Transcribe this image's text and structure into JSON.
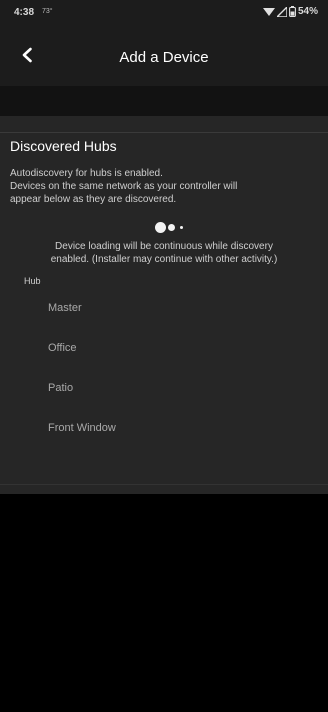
{
  "status_bar": {
    "time": "4:38",
    "temperature": "73°",
    "battery": "54%",
    "icons": [
      "wifi-icon",
      "signal-icon",
      "battery-icon"
    ]
  },
  "header": {
    "title": "Add a Device",
    "back_icon": "chevron-left-icon"
  },
  "discovered": {
    "title": "Discovered Hubs",
    "description_lines": [
      "Autodiscovery for hubs is enabled.",
      "Devices on the same network as your controller will",
      "appear below as they are discovered."
    ],
    "note_lines": [
      "Device loading will be continuous while discovery",
      "enabled. (Installer may continue with other activity.)"
    ],
    "list_header": "Hub",
    "hubs": [
      {
        "label": "Master"
      },
      {
        "label": "Office"
      },
      {
        "label": "Patio"
      },
      {
        "label": "Front Window"
      }
    ]
  },
  "colors": {
    "background": "#000000",
    "header": "#1c1c1c",
    "panel": "#262626",
    "text": "#e6e6e6",
    "muted_text": "#a9a9a9"
  }
}
